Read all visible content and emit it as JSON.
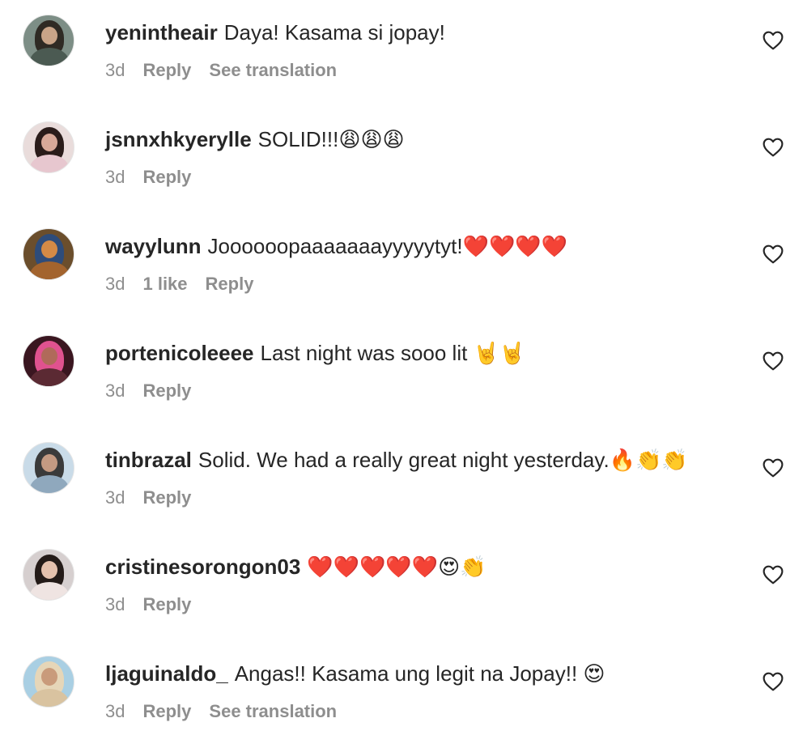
{
  "comments": [
    {
      "username": "yenintheair",
      "text": "Daya! Kasama si jopay!",
      "time": "3d",
      "likes": "",
      "reply_label": "Reply",
      "translation_label": "See translation",
      "avatar_colors": {
        "bg": "#7d8e86",
        "hair": "#2f2a24",
        "face": "#c9a488",
        "shoulders": "#4b5a52"
      }
    },
    {
      "username": "jsnnxhkyerylle",
      "text": "SOLID!!!😩😩😩",
      "time": "3d",
      "likes": "",
      "reply_label": "Reply",
      "translation_label": "",
      "avatar_colors": {
        "bg": "#e9dcdb",
        "hair": "#2a1c1a",
        "face": "#d8a999",
        "shoulders": "#e7c7cf"
      }
    },
    {
      "username": "wayylunn",
      "text": "Joooooopaaaaaaayyyyytyt!❤️❤️❤️❤️",
      "time": "3d",
      "likes": "1 like",
      "reply_label": "Reply",
      "translation_label": "",
      "avatar_colors": {
        "bg": "#6b4e2c",
        "hair": "#2e4c7a",
        "face": "#d48a46",
        "shoulders": "#a3642e"
      }
    },
    {
      "username": "portenicoleeee",
      "text": "Last night was sooo lit 🤘🤘",
      "time": "3d",
      "likes": "",
      "reply_label": "Reply",
      "translation_label": "",
      "avatar_colors": {
        "bg": "#3a1620",
        "hair": "#e0528f",
        "face": "#b06a5a",
        "shoulders": "#5b2a33"
      }
    },
    {
      "username": "tinbrazal",
      "text": "Solid. We had a really great night yesterday.🔥👏👏",
      "time": "3d",
      "likes": "",
      "reply_label": "Reply",
      "translation_label": "",
      "avatar_colors": {
        "bg": "#c9dbe8",
        "hair": "#3a3a3a",
        "face": "#c49a82",
        "shoulders": "#8fa8bd"
      }
    },
    {
      "username": "cristinesorongon03",
      "text": "❤️❤️❤️❤️❤️😍👏",
      "time": "3d",
      "likes": "",
      "reply_label": "Reply",
      "translation_label": "",
      "avatar_colors": {
        "bg": "#d6cfcf",
        "hair": "#241b18",
        "face": "#e5c1ad",
        "shoulders": "#efe4e2"
      }
    },
    {
      "username": "ljaguinaldo_",
      "text": "Angas!! Kasama ung legit na Jopay!! 😍",
      "time": "3d",
      "likes": "",
      "reply_label": "Reply",
      "translation_label": "See translation",
      "avatar_colors": {
        "bg": "#a9cfe3",
        "hair": "#e6d6b8",
        "face": "#c99b7b",
        "shoulders": "#d9c3a0"
      }
    }
  ],
  "icons": {
    "like": "heart-outline-icon"
  }
}
